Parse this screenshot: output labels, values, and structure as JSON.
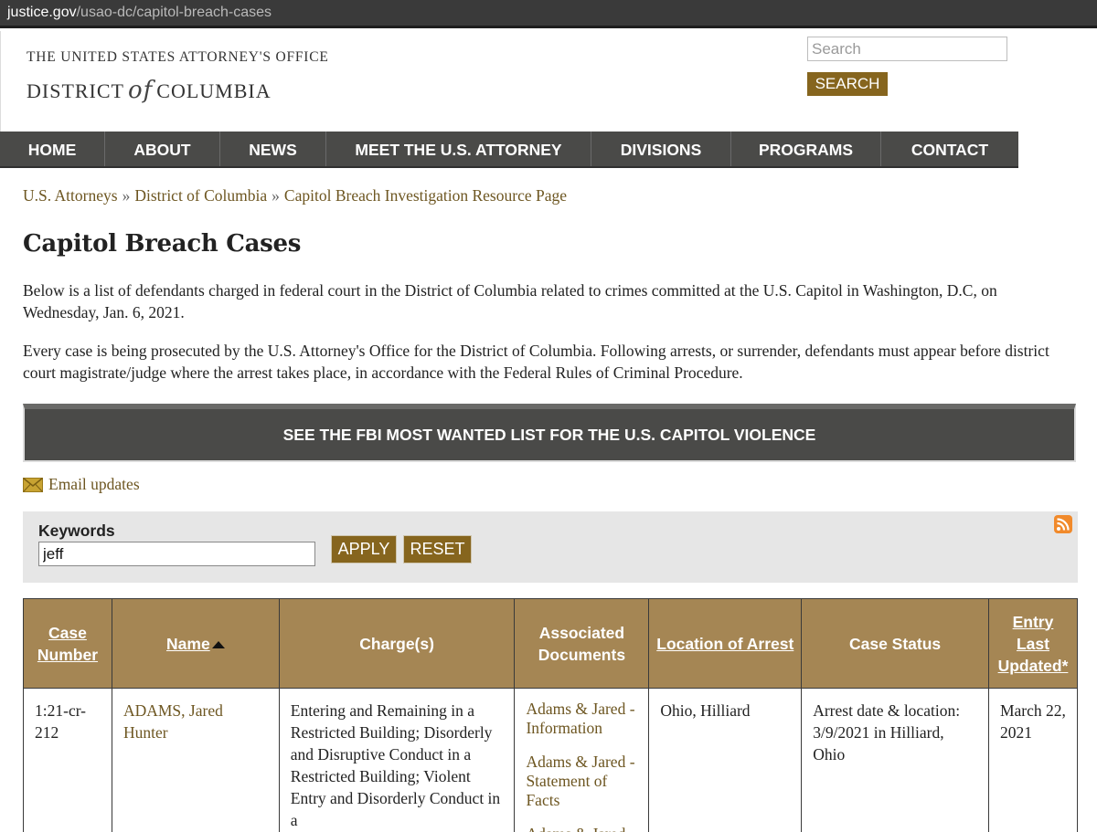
{
  "browser": {
    "url_domain": "justice.gov",
    "url_path": "/usao-dc/capitol-breach-cases"
  },
  "header": {
    "office_line": "THE UNITED STATES ATTORNEY'S OFFICE",
    "district_left": "DISTRICT",
    "district_of": "of",
    "district_right": "COLUMBIA",
    "search_placeholder": "Search",
    "search_button": "SEARCH"
  },
  "nav": {
    "items": [
      {
        "label": "HOME"
      },
      {
        "label": "ABOUT"
      },
      {
        "label": "NEWS"
      },
      {
        "label": "MEET THE U.S. ATTORNEY"
      },
      {
        "label": "DIVISIONS"
      },
      {
        "label": "PROGRAMS"
      },
      {
        "label": "CONTACT"
      }
    ]
  },
  "breadcrumb": {
    "items": [
      "U.S. Attorneys",
      "District of Columbia",
      "Capitol Breach Investigation Resource Page"
    ],
    "separator": "»"
  },
  "page": {
    "title": "Capitol Breach Cases",
    "para1": "Below is a list of defendants charged in federal court in the District of Columbia related to crimes committed at the U.S. Capitol in Washington, D.C, on Wednesday, Jan. 6, 2021.",
    "para2": "Every case is being prosecuted by the U.S. Attorney's Office for the District of Columbia. Following arrests, or surrender, defendants must appear before district court magistrate/judge where the arrest takes place, in accordance with the Federal Rules of Criminal Procedure.",
    "fbi_banner": "SEE THE FBI MOST WANTED LIST FOR THE U.S. CAPITOL VIOLENCE",
    "email_updates": "Email updates"
  },
  "filter": {
    "keywords_label": "Keywords",
    "keywords_value": "jeff",
    "apply_label": "APPLY",
    "reset_label": "RESET"
  },
  "table": {
    "headers": {
      "case_number": "Case Number",
      "name": "Name",
      "charges": "Charge(s)",
      "documents": "Associated Documents",
      "location": "Location of Arrest",
      "status": "Case Status",
      "updated": "Entry Last Updated*"
    },
    "rows": [
      {
        "case_number": "1:21-cr-212",
        "name": "ADAMS, Jared Hunter",
        "charges": "Entering and Remaining in a Restricted Building; Disorderly and Disruptive Conduct in a Restricted Building; Violent Entry and Disorderly Conduct in a",
        "documents": [
          "Adams & Jared - Information",
          "Adams & Jared - Statement of Facts",
          "Adams & Jared"
        ],
        "location": "Ohio, Hilliard",
        "status": "Arrest date & location: 3/9/2021 in Hilliard, Ohio",
        "updated": "March 22, 2021"
      }
    ]
  },
  "colors": {
    "nav_bg": "#4a4a48",
    "gold_button": "#86651e",
    "table_header": "#a58654",
    "link": "#6d5621"
  }
}
